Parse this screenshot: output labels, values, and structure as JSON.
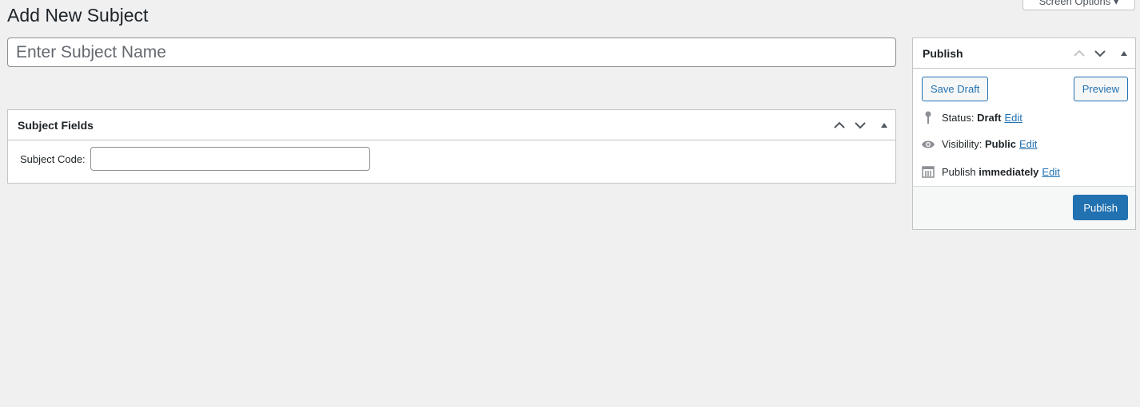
{
  "page_title": "Add New Subject",
  "screen_options": "Screen Options",
  "title_input": {
    "placeholder": "Enter Subject Name",
    "value": ""
  },
  "subject_fields": {
    "title": "Subject Fields",
    "code_label": "Subject Code:",
    "code_value": ""
  },
  "publish": {
    "title": "Publish",
    "save_draft": "Save Draft",
    "preview": "Preview",
    "status_label": "Status:",
    "status_value": "Draft",
    "visibility_label": "Visibility:",
    "visibility_value": "Public",
    "publish_label": "Publish",
    "publish_value": "immediately",
    "edit": "Edit",
    "publish_button": "Publish"
  },
  "colors": {
    "accent": "#2271b1",
    "background": "#f0f0f1"
  }
}
